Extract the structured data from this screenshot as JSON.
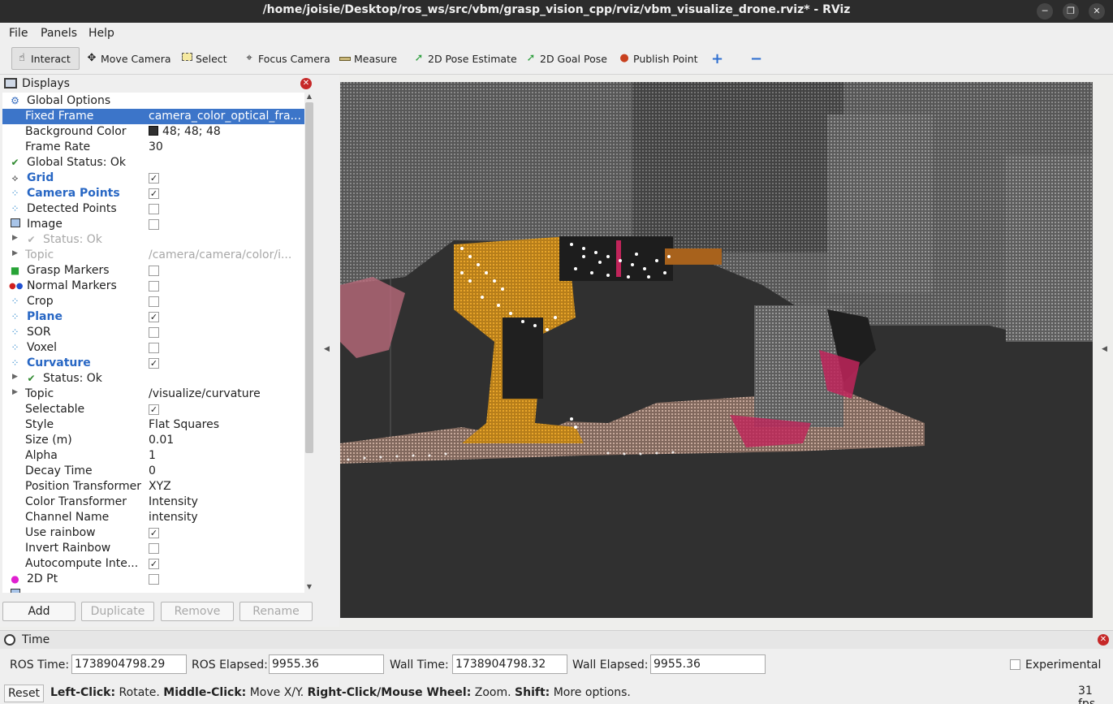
{
  "window": {
    "title": "/home/joisie/Desktop/ros_ws/src/vbm/grasp_vision_cpp/rviz/vbm_visualize_drone.rviz* - RViz"
  },
  "menu": [
    "File",
    "Panels",
    "Help"
  ],
  "toolbar": {
    "tools": [
      {
        "label": "Interact",
        "icon": "hand-cursor-icon"
      },
      {
        "label": "Move Camera",
        "icon": "move-arrows-icon"
      },
      {
        "label": "Select",
        "icon": "select-rectangle-icon"
      },
      {
        "label": "Focus Camera",
        "icon": "focus-target-icon"
      },
      {
        "label": "Measure",
        "icon": "ruler-icon"
      },
      {
        "label": "2D Pose Estimate",
        "icon": "green-arrow-icon"
      },
      {
        "label": "2D Goal Pose",
        "icon": "green-arrow-icon"
      },
      {
        "label": "Publish Point",
        "icon": "map-pin-icon"
      }
    ],
    "accent": "#2a9d3a",
    "pin_color": "#c8401e"
  },
  "displays": {
    "title": "Displays",
    "rows": [
      {
        "name": "Global Options",
        "value": ""
      },
      {
        "name": "Fixed Frame",
        "value": "camera_color_optical_fra..."
      },
      {
        "name": "Background Color",
        "value": "48; 48; 48"
      },
      {
        "name": "Frame Rate",
        "value": "30"
      },
      {
        "name": "Global Status: Ok",
        "value": ""
      },
      {
        "name": "Grid",
        "value": ""
      },
      {
        "name": "Camera Points",
        "value": ""
      },
      {
        "name": "Detected Points",
        "value": ""
      },
      {
        "name": "Image",
        "value": ""
      },
      {
        "name": "Status: Ok",
        "value": ""
      },
      {
        "name": "Topic",
        "value": "/camera/camera/color/i..."
      },
      {
        "name": "Grasp Markers",
        "value": ""
      },
      {
        "name": "Normal Markers",
        "value": ""
      },
      {
        "name": "Crop",
        "value": ""
      },
      {
        "name": "Plane",
        "value": ""
      },
      {
        "name": "SOR",
        "value": ""
      },
      {
        "name": "Voxel",
        "value": ""
      },
      {
        "name": "Curvature",
        "value": ""
      },
      {
        "name": "Status: Ok",
        "value": ""
      },
      {
        "name": "Topic",
        "value": "/visualize/curvature"
      },
      {
        "name": "Selectable",
        "value": ""
      },
      {
        "name": "Style",
        "value": "Flat Squares"
      },
      {
        "name": "Size (m)",
        "value": "0.01"
      },
      {
        "name": "Alpha",
        "value": "1"
      },
      {
        "name": "Decay Time",
        "value": "0"
      },
      {
        "name": "Position Transformer",
        "value": "XYZ"
      },
      {
        "name": "Color Transformer",
        "value": "Intensity"
      },
      {
        "name": "Channel Name",
        "value": "intensity"
      },
      {
        "name": "Use rainbow",
        "value": ""
      },
      {
        "name": "Invert Rainbow",
        "value": ""
      },
      {
        "name": "Autocompute Inte...",
        "value": ""
      },
      {
        "name": "2D Pt",
        "value": ""
      }
    ],
    "checks": {
      "grid": true,
      "camera_points": true,
      "detected_points": false,
      "image": false,
      "grasp_markers": false,
      "normal_markers": false,
      "crop": false,
      "plane": true,
      "sor": false,
      "voxel": false,
      "curvature": true,
      "selectable": true,
      "use_rainbow": true,
      "invert_rainbow": false,
      "autocompute": true,
      "pt2d": false
    },
    "buttons": {
      "add": "Add",
      "duplicate": "Duplicate",
      "remove": "Remove",
      "rename": "Rename"
    }
  },
  "time": {
    "title": "Time",
    "ros_time_label": "ROS Time:",
    "ros_time": "1738904798.29",
    "ros_elapsed_label": "ROS Elapsed:",
    "ros_elapsed": "9955.36",
    "wall_time_label": "Wall Time:",
    "wall_time": "1738904798.32",
    "wall_elapsed_label": "Wall Elapsed:",
    "wall_elapsed": "9955.36",
    "experimental_label": "Experimental"
  },
  "status": {
    "reset": "Reset",
    "h1b": "Left-Click:",
    "h1": " Rotate. ",
    "h2b": "Middle-Click:",
    "h2": " Move X/Y. ",
    "h3b": "Right-Click/Mouse Wheel:",
    "h3": " Zoom. ",
    "h4b": "Shift:",
    "h4": " More options.",
    "fps": "31 fps"
  },
  "render": {
    "background": "#303030",
    "drill_color": "#e0a020",
    "marker_color": "#ffffff"
  }
}
